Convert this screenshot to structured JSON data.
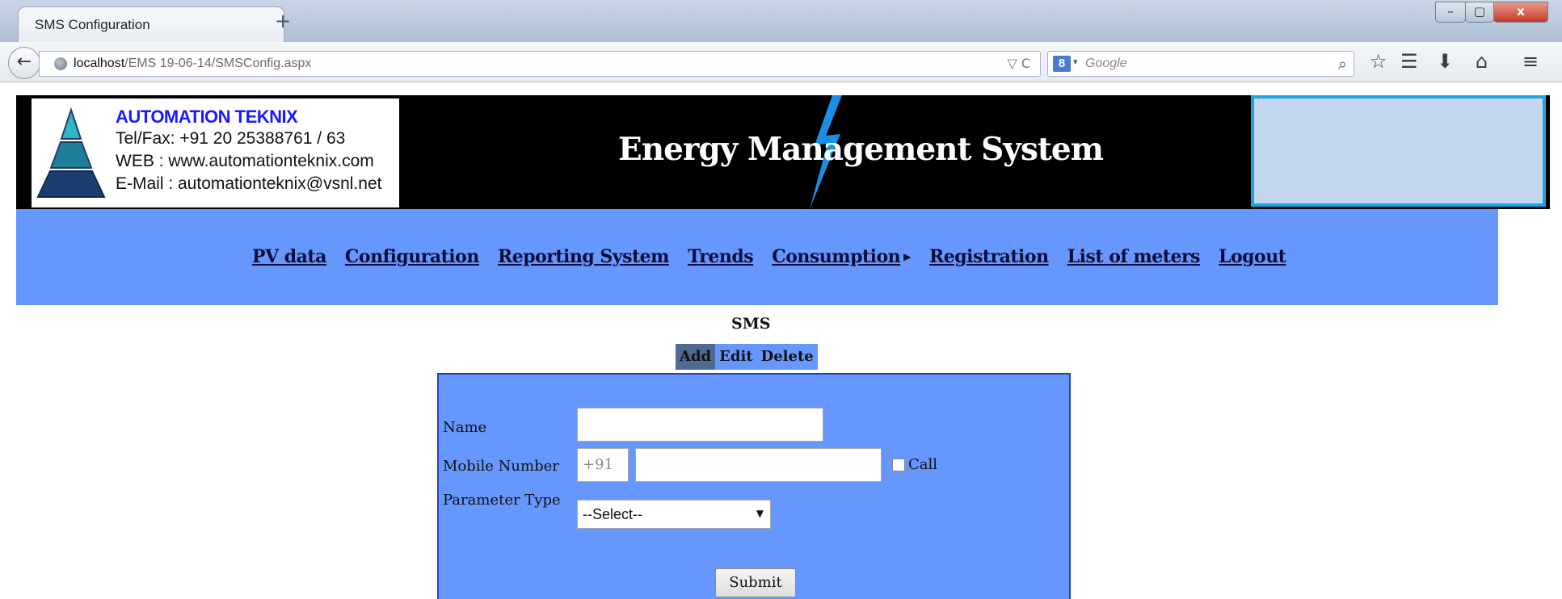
{
  "browser": {
    "tab_title": "SMS Configuration",
    "new_tab": "+",
    "window_controls": {
      "minimize": "–",
      "maximize": "▢",
      "close": "x"
    },
    "url_host": "localhost",
    "url_path": "/EMS 19-06-14/SMSConfig.aspx",
    "url_icons": "▽ C",
    "search_engine": "8",
    "search_placeholder": "Google"
  },
  "header": {
    "company": "AUTOMATION TEKNIX",
    "tel": "Tel/Fax: +91 20 25388761 / 63",
    "web": "WEB   : www.automationteknix.com",
    "email": "E-Mail : automationteknix@vsnl.net",
    "system_title": "Energy Management System"
  },
  "menu": {
    "items": [
      "PV data",
      "Configuration",
      "Reporting System",
      "Trends",
      "Consumption",
      "Registration",
      "List of meters",
      "Logout"
    ]
  },
  "sms": {
    "title": "SMS",
    "tabs": [
      "Add",
      "Edit",
      "Delete"
    ],
    "active_tab": "Add"
  },
  "form": {
    "name_label": "Name",
    "name_value": "",
    "mobile_label": "Mobile Number",
    "mobile_prefix": "+91",
    "mobile_value": "",
    "call_label": "Call",
    "call_checked": false,
    "parameter_label": "Parameter Type",
    "parameter_selected": "--Select--",
    "submit_label": "Submit"
  },
  "colors": {
    "menu_bg": "#6697fc",
    "banner_bg": "#000000",
    "company_text": "#1a1aff",
    "active_tab_bg": "#4f6b92"
  }
}
